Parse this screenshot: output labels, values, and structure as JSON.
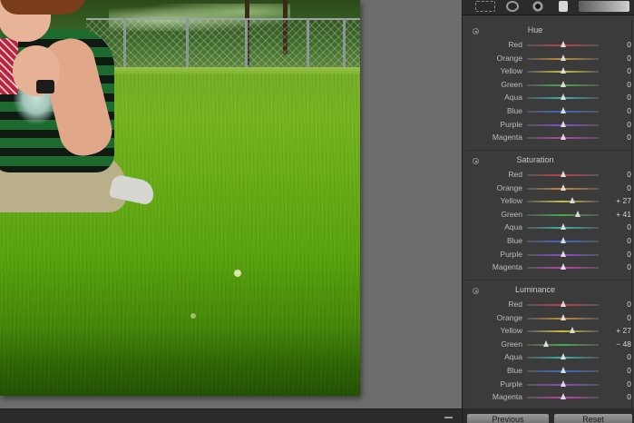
{
  "hsl_panel": {
    "sections": [
      {
        "title": "Hue",
        "rows": [
          {
            "label": "Red",
            "value": "0",
            "position": 0.5,
            "color": "#c0404a"
          },
          {
            "label": "Orange",
            "value": "0",
            "position": 0.5,
            "color": "#c98a3a"
          },
          {
            "label": "Yellow",
            "value": "0",
            "position": 0.5,
            "color": "#c8c040"
          },
          {
            "label": "Green",
            "value": "0",
            "position": 0.5,
            "color": "#4aa84a"
          },
          {
            "label": "Aqua",
            "value": "0",
            "position": 0.5,
            "color": "#3ab0b0"
          },
          {
            "label": "Blue",
            "value": "0",
            "position": 0.5,
            "color": "#3a6ad0"
          },
          {
            "label": "Purple",
            "value": "0",
            "position": 0.5,
            "color": "#8a4ad0"
          },
          {
            "label": "Magenta",
            "value": "0",
            "position": 0.5,
            "color": "#c040b0"
          }
        ]
      },
      {
        "title": "Saturation",
        "rows": [
          {
            "label": "Red",
            "value": "0",
            "position": 0.5,
            "color": "#c0404a"
          },
          {
            "label": "Orange",
            "value": "0",
            "position": 0.5,
            "color": "#c98a3a"
          },
          {
            "label": "Yellow",
            "value": "+ 27",
            "position": 0.635,
            "color": "#c8c040"
          },
          {
            "label": "Green",
            "value": "+ 41",
            "position": 0.705,
            "color": "#4aa84a"
          },
          {
            "label": "Aqua",
            "value": "0",
            "position": 0.5,
            "color": "#3ab0b0"
          },
          {
            "label": "Blue",
            "value": "0",
            "position": 0.5,
            "color": "#3a6ad0"
          },
          {
            "label": "Purple",
            "value": "0",
            "position": 0.5,
            "color": "#8a4ad0"
          },
          {
            "label": "Magenta",
            "value": "0",
            "position": 0.5,
            "color": "#c040b0"
          }
        ]
      },
      {
        "title": "Luminance",
        "rows": [
          {
            "label": "Red",
            "value": "0",
            "position": 0.5,
            "color": "#c0404a"
          },
          {
            "label": "Orange",
            "value": "0",
            "position": 0.5,
            "color": "#c98a3a"
          },
          {
            "label": "Yellow",
            "value": "+ 27",
            "position": 0.635,
            "color": "#c8c040"
          },
          {
            "label": "Green",
            "value": "− 48",
            "position": 0.26,
            "color": "#4aa84a"
          },
          {
            "label": "Aqua",
            "value": "0",
            "position": 0.5,
            "color": "#3ab0b0"
          },
          {
            "label": "Blue",
            "value": "0",
            "position": 0.5,
            "color": "#3a6ad0"
          },
          {
            "label": "Purple",
            "value": "0",
            "position": 0.5,
            "color": "#8a4ad0"
          },
          {
            "label": "Magenta",
            "value": "0",
            "position": 0.5,
            "color": "#c040b0"
          }
        ]
      }
    ]
  },
  "buttons": {
    "previous": "Previous",
    "reset": "Reset"
  },
  "toolstrip": {
    "icons": [
      "crop-icon",
      "spot-removal-icon",
      "red-eye-icon",
      "graduated-filter-icon",
      "adjustment-brush-icon"
    ]
  }
}
